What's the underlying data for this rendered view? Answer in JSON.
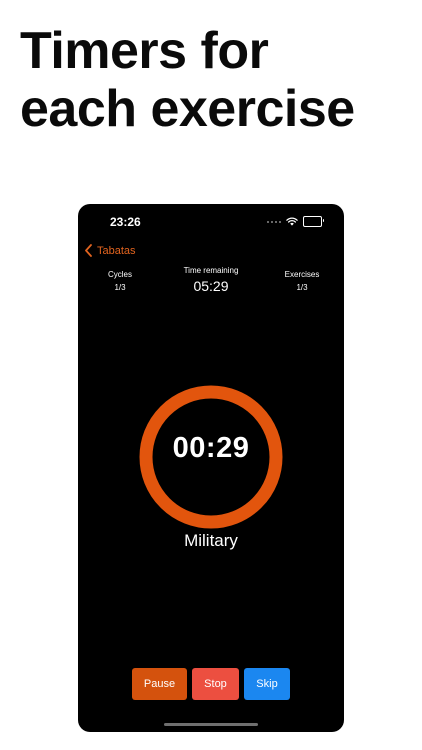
{
  "headline": {
    "line1": "Timers for",
    "line2": "each exercise"
  },
  "status_bar": {
    "time": "23:26"
  },
  "nav": {
    "back_label": "Tabatas"
  },
  "stats": {
    "cycles": {
      "label": "Cycles",
      "value": "1/3"
    },
    "time_remaining": {
      "label": "Time remaining",
      "value": "05:29"
    },
    "exercises": {
      "label": "Exercises",
      "value": "1/3"
    }
  },
  "timer": {
    "display": "00:29",
    "exercise_name": "Military"
  },
  "controls": {
    "pause_label": "Pause",
    "stop_label": "Stop",
    "skip_label": "Skip"
  },
  "colors": {
    "accent": "#e2641f",
    "ring": "#e2550d",
    "pause": "#d4520d",
    "stop": "#ec4f40",
    "skip": "#1b87f0",
    "background": "#000000"
  }
}
